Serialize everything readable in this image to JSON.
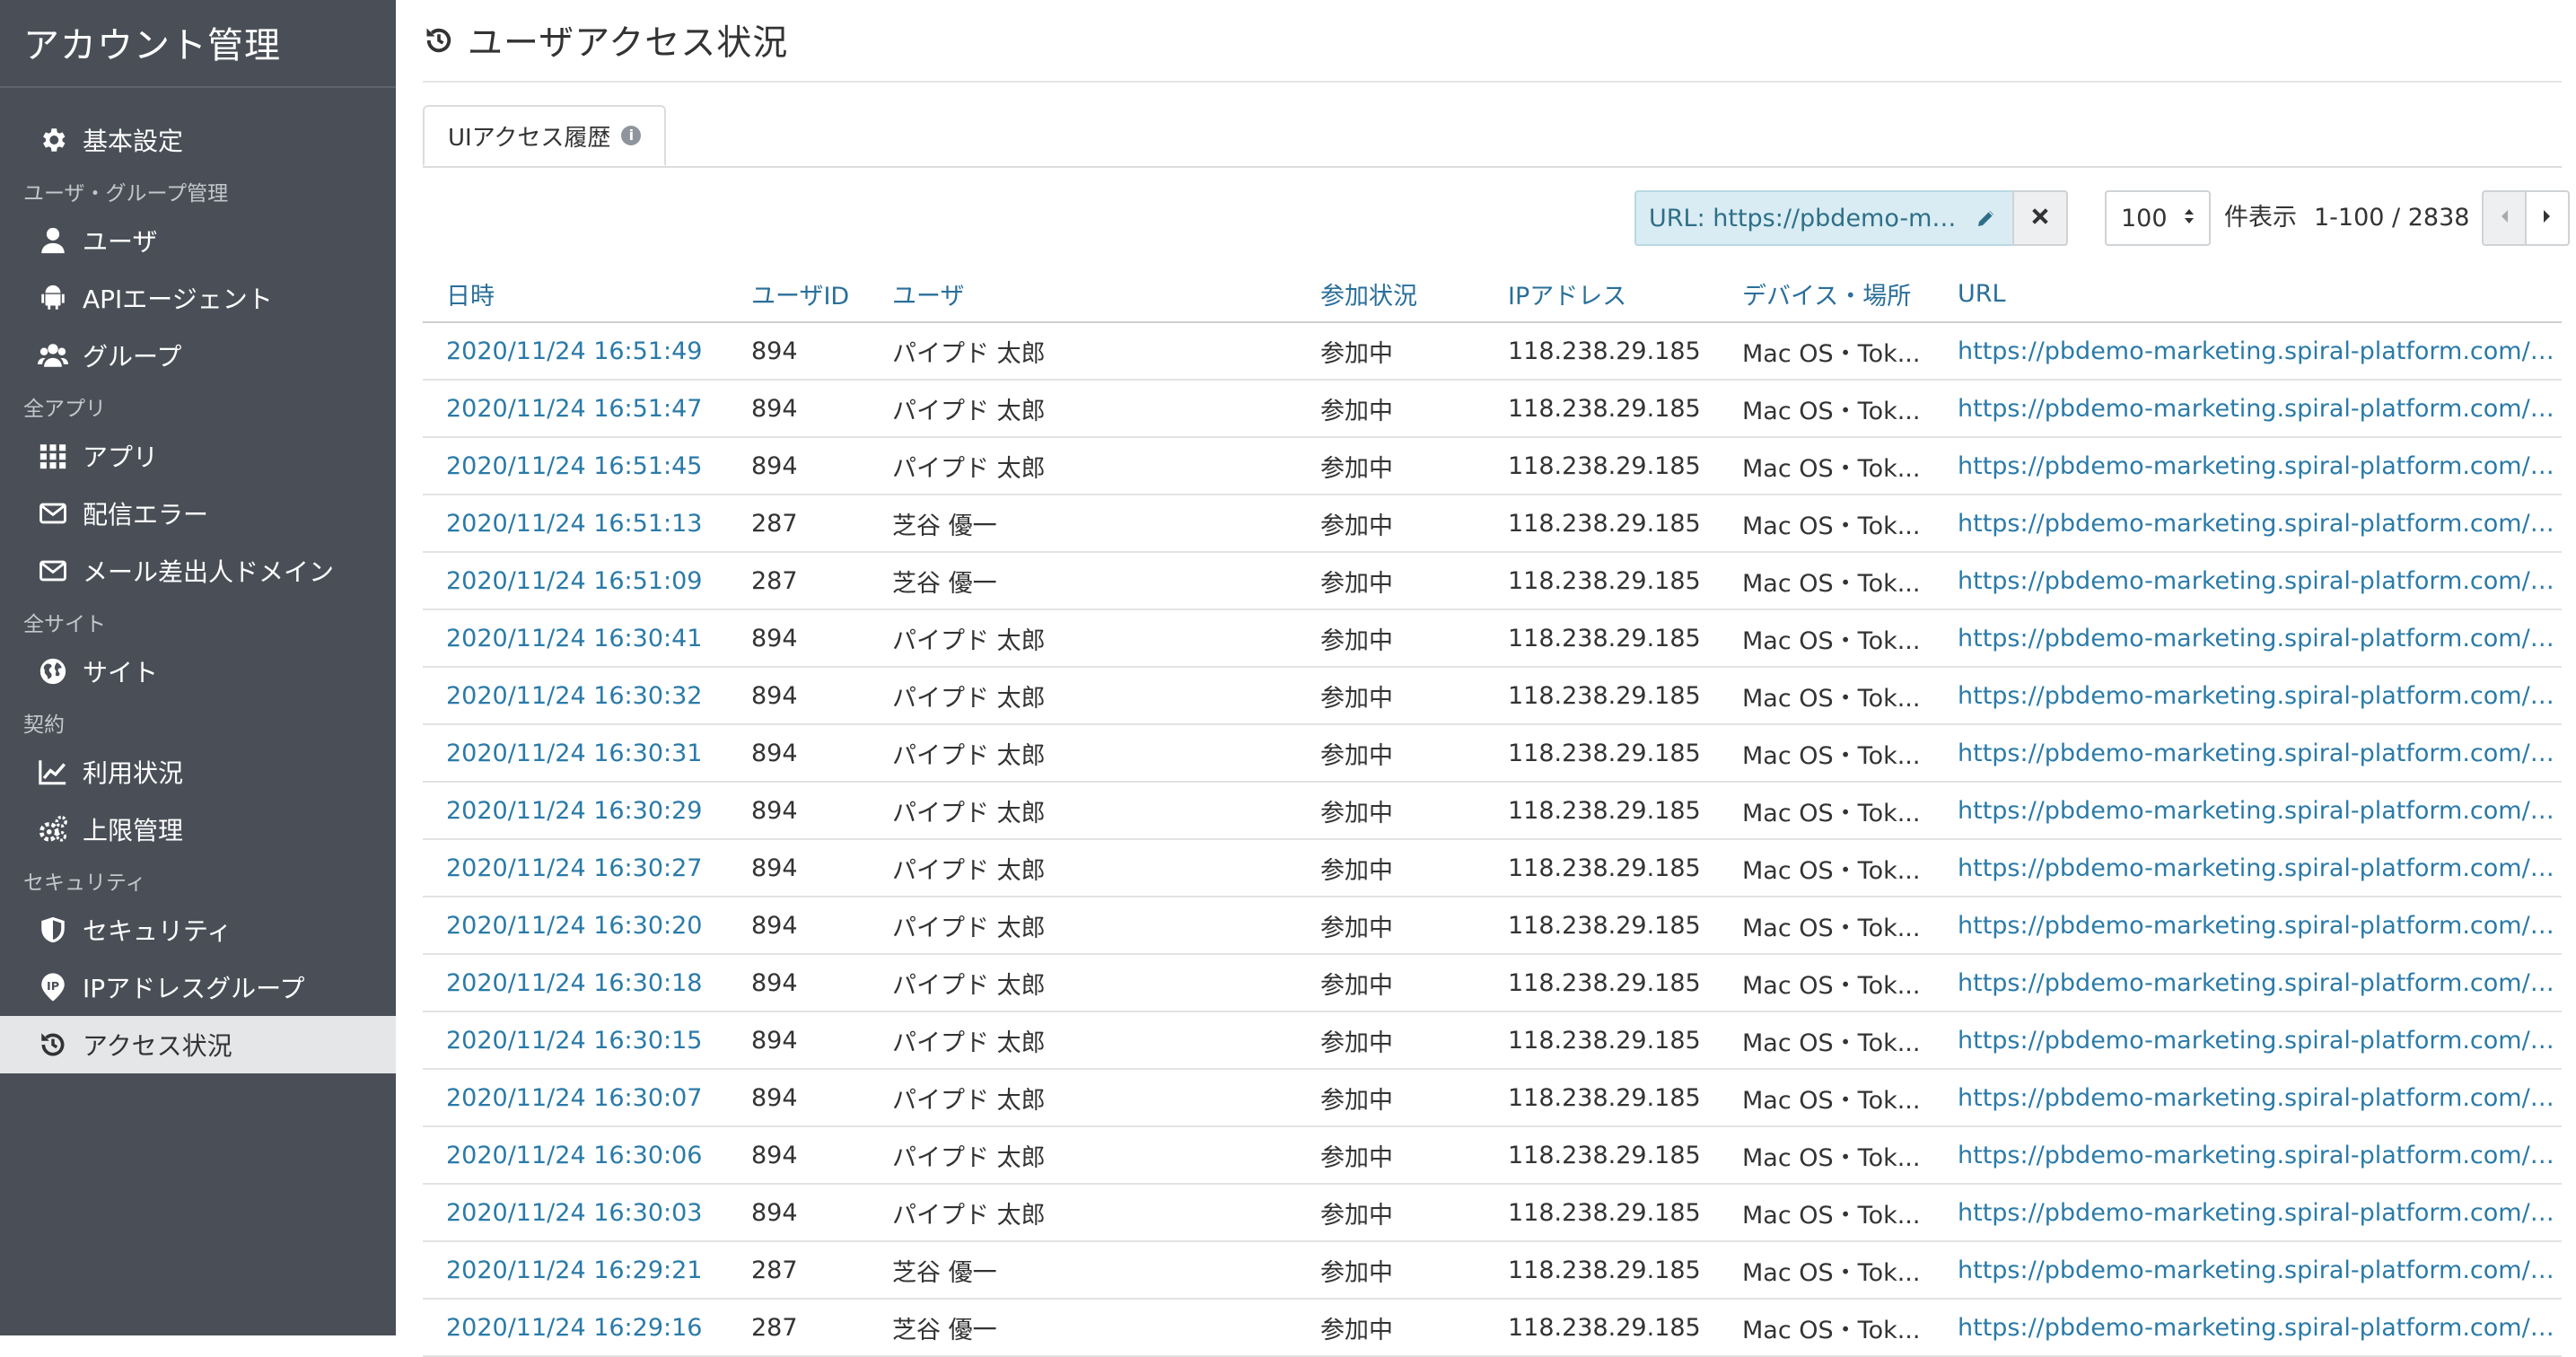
{
  "sidebar": {
    "title": "アカウント管理",
    "items": {
      "basic": {
        "label": "基本設定",
        "icon": "gear-icon"
      },
      "users": {
        "label": "ユーザ",
        "icon": "user-icon"
      },
      "api_agent": {
        "label": "APIエージェント",
        "icon": "android-icon"
      },
      "groups": {
        "label": "グループ",
        "icon": "users-icon"
      },
      "apps": {
        "label": "アプリ",
        "icon": "grid-icon"
      },
      "delivery_errors": {
        "label": "配信エラー",
        "icon": "envelope-icon"
      },
      "mail_domain": {
        "label": "メール差出人ドメイン",
        "icon": "envelope-icon"
      },
      "sites": {
        "label": "サイト",
        "icon": "globe-icon"
      },
      "usage": {
        "label": "利用状況",
        "icon": "line-chart-icon"
      },
      "limits": {
        "label": "上限管理",
        "icon": "gears-icon"
      },
      "security": {
        "label": "セキュリティ",
        "icon": "shield-icon"
      },
      "ip_groups": {
        "label": "IPアドレスグループ",
        "icon": "ip-icon"
      },
      "access": {
        "label": "アクセス状況",
        "icon": "history-icon"
      }
    },
    "sections": {
      "user_group": "ユーザ・グループ管理",
      "all_apps": "全アプリ",
      "all_sites": "全サイト",
      "contract": "契約",
      "security": "セキュリティ"
    }
  },
  "page": {
    "title": "ユーザアクセス状況"
  },
  "tabs": {
    "ui_history": "UIアクセス履歴",
    "info_icon": "i"
  },
  "toolbar": {
    "filter": "URL: https://pbdemo-marketing.spiral-platform.com/admin",
    "per_page": "100",
    "per_page_label": "件表示",
    "range": "1-100 / 2838"
  },
  "table": {
    "columns": {
      "datetime": "日時",
      "user_id": "ユーザID",
      "user": "ユーザ",
      "status": "参加状況",
      "ip": "IPアドレス",
      "device": "デバイス・場所",
      "url": "URL"
    },
    "rows": [
      {
        "datetime": "2020/11/24 16:51:49",
        "user_id": "894",
        "user": "パイプド 太郎",
        "status": "参加中",
        "ip": "118.238.29.185",
        "device": "Mac OS・Tok...",
        "url": "https://pbdemo-marketing.spiral-platform.com/admi..."
      },
      {
        "datetime": "2020/11/24 16:51:47",
        "user_id": "894",
        "user": "パイプド 太郎",
        "status": "参加中",
        "ip": "118.238.29.185",
        "device": "Mac OS・Tok...",
        "url": "https://pbdemo-marketing.spiral-platform.com/admi..."
      },
      {
        "datetime": "2020/11/24 16:51:45",
        "user_id": "894",
        "user": "パイプド 太郎",
        "status": "参加中",
        "ip": "118.238.29.185",
        "device": "Mac OS・Tok...",
        "url": "https://pbdemo-marketing.spiral-platform.com/user-..."
      },
      {
        "datetime": "2020/11/24 16:51:13",
        "user_id": "287",
        "user": "芝谷 優一",
        "status": "参加中",
        "ip": "118.238.29.185",
        "device": "Mac OS・Tok...",
        "url": "https://pbdemo-marketing.spiral-platform.com/admi..."
      },
      {
        "datetime": "2020/11/24 16:51:09",
        "user_id": "287",
        "user": "芝谷 優一",
        "status": "参加中",
        "ip": "118.238.29.185",
        "device": "Mac OS・Tok...",
        "url": "https://pbdemo-marketing.spiral-platform.com/user-..."
      },
      {
        "datetime": "2020/11/24 16:30:41",
        "user_id": "894",
        "user": "パイプド 太郎",
        "status": "参加中",
        "ip": "118.238.29.185",
        "device": "Mac OS・Tok...",
        "url": "https://pbdemo-marketing.spiral-platform.com/admi..."
      },
      {
        "datetime": "2020/11/24 16:30:32",
        "user_id": "894",
        "user": "パイプド 太郎",
        "status": "参加中",
        "ip": "118.238.29.185",
        "device": "Mac OS・Tok...",
        "url": "https://pbdemo-marketing.spiral-platform.com/admi..."
      },
      {
        "datetime": "2020/11/24 16:30:31",
        "user_id": "894",
        "user": "パイプド 太郎",
        "status": "参加中",
        "ip": "118.238.29.185",
        "device": "Mac OS・Tok...",
        "url": "https://pbdemo-marketing.spiral-platform.com/admi..."
      },
      {
        "datetime": "2020/11/24 16:30:29",
        "user_id": "894",
        "user": "パイプド 太郎",
        "status": "参加中",
        "ip": "118.238.29.185",
        "device": "Mac OS・Tok...",
        "url": "https://pbdemo-marketing.spiral-platform.com/admi..."
      },
      {
        "datetime": "2020/11/24 16:30:27",
        "user_id": "894",
        "user": "パイプド 太郎",
        "status": "参加中",
        "ip": "118.238.29.185",
        "device": "Mac OS・Tok...",
        "url": "https://pbdemo-marketing.spiral-platform.com/admi..."
      },
      {
        "datetime": "2020/11/24 16:30:20",
        "user_id": "894",
        "user": "パイプド 太郎",
        "status": "参加中",
        "ip": "118.238.29.185",
        "device": "Mac OS・Tok...",
        "url": "https://pbdemo-marketing.spiral-platform.com/admi..."
      },
      {
        "datetime": "2020/11/24 16:30:18",
        "user_id": "894",
        "user": "パイプド 太郎",
        "status": "参加中",
        "ip": "118.238.29.185",
        "device": "Mac OS・Tok...",
        "url": "https://pbdemo-marketing.spiral-platform.com/admi..."
      },
      {
        "datetime": "2020/11/24 16:30:15",
        "user_id": "894",
        "user": "パイプド 太郎",
        "status": "参加中",
        "ip": "118.238.29.185",
        "device": "Mac OS・Tok...",
        "url": "https://pbdemo-marketing.spiral-platform.com/admi..."
      },
      {
        "datetime": "2020/11/24 16:30:07",
        "user_id": "894",
        "user": "パイプド 太郎",
        "status": "参加中",
        "ip": "118.238.29.185",
        "device": "Mac OS・Tok...",
        "url": "https://pbdemo-marketing.spiral-platform.com/user-..."
      },
      {
        "datetime": "2020/11/24 16:30:06",
        "user_id": "894",
        "user": "パイプド 太郎",
        "status": "参加中",
        "ip": "118.238.29.185",
        "device": "Mac OS・Tok...",
        "url": "https://pbdemo-marketing.spiral-platform.com/user-..."
      },
      {
        "datetime": "2020/11/24 16:30:03",
        "user_id": "894",
        "user": "パイプド 太郎",
        "status": "参加中",
        "ip": "118.238.29.185",
        "device": "Mac OS・Tok...",
        "url": "https://pbdemo-marketing.spiral-platform.com/user-..."
      },
      {
        "datetime": "2020/11/24 16:29:21",
        "user_id": "287",
        "user": "芝谷 優一",
        "status": "参加中",
        "ip": "118.238.29.185",
        "device": "Mac OS・Tok...",
        "url": "https://pbdemo-marketing.spiral-platform.com/admi..."
      },
      {
        "datetime": "2020/11/24 16:29:16",
        "user_id": "287",
        "user": "芝谷 優一",
        "status": "参加中",
        "ip": "118.238.29.185",
        "device": "Mac OS・Tok...",
        "url": "https://pbdemo-marketing.spiral-platform.com/reaut..."
      }
    ]
  },
  "colors": {
    "sidebar_bg": "#4a4f57",
    "active_bg": "#e5e6e8",
    "link": "#2a7aa8",
    "filter_bg": "#d9ecf3"
  }
}
